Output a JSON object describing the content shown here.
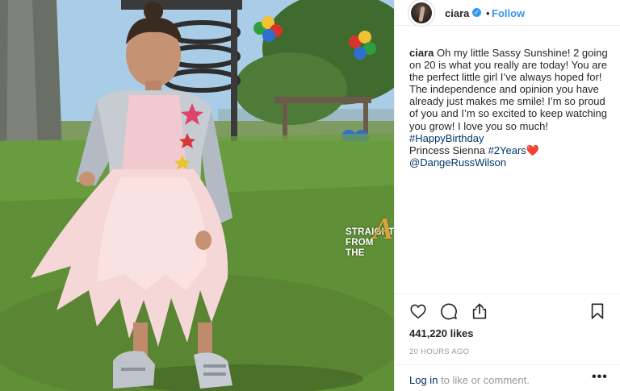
{
  "post": {
    "username": "ciara",
    "verified_icon": "verified-badge-icon",
    "separator": "•",
    "follow_label": "Follow",
    "caption": {
      "username": "ciara",
      "text": "Oh my little Sassy Sunshine! 2 going on 20 is what you really are today! You are the perfect little girl I’ve always hoped for! The independence and opinion you have already just makes me smile! I’m so proud of you and I’m so excited to keep watching you grow! I love you so much! ",
      "hashtag_birthday": "#HappyBirthday",
      "line_princess": "Princess Sienna ",
      "hashtag_years": "#2Years",
      "heart": "❤️",
      "mention": "@DangeRussWilson"
    },
    "likes": "441,220 likes",
    "timestamp": "20 HOURS AGO",
    "login": {
      "link": "Log in",
      "rest": " to like or comment."
    },
    "more_label": "•••",
    "icons": {
      "like": "heart-icon",
      "comment": "comment-icon",
      "share": "share-icon",
      "save": "bookmark-icon"
    },
    "colors": {
      "link": "#003569",
      "follow": "#3897f0",
      "muted": "#999999",
      "heart": "#e8322d"
    }
  },
  "watermark": {
    "line1": "STRAIGHT",
    "line2": "FROM",
    "line3": "THE",
    "letter": "A"
  }
}
